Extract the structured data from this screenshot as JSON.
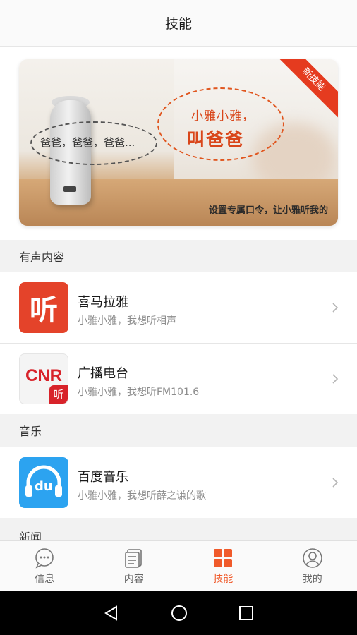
{
  "header": {
    "title": "技能"
  },
  "banner": {
    "ribbon_label": "新技能",
    "bubble_left_text": "爸爸，爸爸，爸爸...",
    "bubble_right_line1": "小雅小雅，",
    "bubble_right_line2": "叫爸爸",
    "caption": "设置专属口令，让小雅听我的"
  },
  "sections": [
    {
      "title": "有声内容",
      "items": [
        {
          "name": "喜马拉雅",
          "subtitle": "小雅小雅，我想听相声",
          "icon": "ximalaya-icon",
          "icon_text": "听"
        },
        {
          "name": "广播电台",
          "subtitle": "小雅小雅，我想听FM101.6",
          "icon": "cnr-icon",
          "icon_text": "CNR",
          "icon_badge": "听"
        }
      ]
    },
    {
      "title": "音乐",
      "items": [
        {
          "name": "百度音乐",
          "subtitle": "小雅小雅，我想听薛之谦的歌",
          "icon": "baidu-music-icon",
          "icon_text": "du"
        }
      ]
    },
    {
      "title": "新闻",
      "items": []
    }
  ],
  "tabs": [
    {
      "label": "信息",
      "icon": "chat-bubble-icon",
      "active": false
    },
    {
      "label": "内容",
      "icon": "document-icon",
      "active": false
    },
    {
      "label": "技能",
      "icon": "grid-icon",
      "active": true
    },
    {
      "label": "我的",
      "icon": "user-icon",
      "active": false
    }
  ],
  "colors": {
    "accent": "#f05a2a",
    "ximalaya": "#e4432a",
    "baidu": "#2ca3f0",
    "cnr_red": "#d8232a"
  }
}
